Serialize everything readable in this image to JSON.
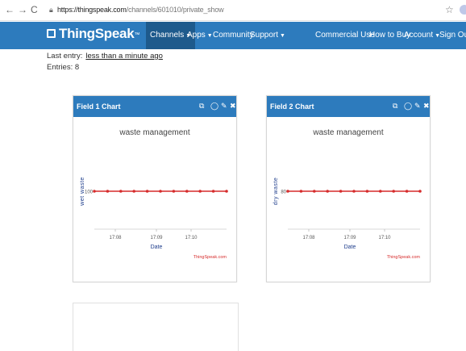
{
  "browser": {
    "url_scheme": "https",
    "url_host": "://thingspeak.com",
    "url_path": "/channels/601010/private_show"
  },
  "navbar": {
    "brand": "ThingSpeak",
    "brand_tm": "™",
    "items": [
      {
        "label": "Channels"
      },
      {
        "label": "Apps"
      },
      {
        "label": "Community"
      },
      {
        "label": "Support"
      }
    ],
    "right_items": [
      {
        "label": "Commercial Use"
      },
      {
        "label": "How to Buy"
      },
      {
        "label": "Account"
      },
      {
        "label": "Sign Out"
      }
    ]
  },
  "channel": {
    "last_entry_label": "Last entry:",
    "last_entry_value": "less than a minute ago",
    "entries_label": "Entries: 8"
  },
  "panels": [
    {
      "title": "Field 1 Chart"
    },
    {
      "title": "Field 2 Chart"
    }
  ],
  "colors": {
    "primary": "#2d7bbd",
    "active_nav": "#1e5a8c",
    "series": "#d62c2c",
    "axis_label": "#1f3e8c"
  },
  "icons": [
    "back-icon",
    "forward-icon",
    "reload-icon",
    "lock-icon",
    "star-icon",
    "external-link-icon",
    "comment-icon",
    "pencil-icon",
    "close-icon"
  ],
  "chart_data": [
    {
      "type": "line",
      "title": "waste management",
      "xlabel": "Date",
      "ylabel": "wet waste",
      "x_ticks": [
        "17:08",
        "17:09",
        "17:10"
      ],
      "y_ticks": [
        100
      ],
      "credit": "ThingSpeak.com",
      "series": [
        {
          "values": [
            100,
            100,
            100,
            100,
            100,
            100,
            100,
            100,
            100,
            100,
            100
          ]
        }
      ]
    },
    {
      "type": "line",
      "title": "waste management",
      "xlabel": "Date",
      "ylabel": "dry waste",
      "x_ticks": [
        "17:08",
        "17:09",
        "17:10"
      ],
      "y_ticks": [
        80
      ],
      "credit": "ThingSpeak.com",
      "series": [
        {
          "values": [
            80,
            80,
            80,
            80,
            80,
            80,
            80,
            80,
            80,
            80,
            80
          ]
        }
      ]
    }
  ]
}
